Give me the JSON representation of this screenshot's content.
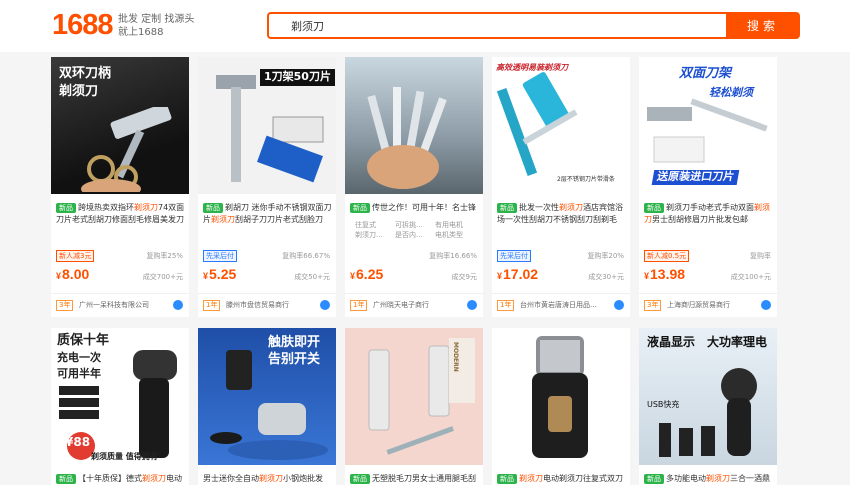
{
  "header": {
    "logo": "1688",
    "slogan_line1": "批发 定制 找源头",
    "slogan_line2": "就上1688",
    "search_value": "剃须刀",
    "search_button": "搜索"
  },
  "row1": [
    {
      "img_text1": "双环刀柄",
      "img_text2": "剃须刀",
      "badge": "新品",
      "desc_pre": "跨境热卖双指环",
      "desc_hl": "剃须刀",
      "desc_post": "74双面刀片老式刮胡刀修面刮毛修眉美发刀",
      "tag": "新人减3元",
      "repurchase": "复购率25%",
      "price": "8.00",
      "sold": "成交700+元",
      "years": "3年",
      "shop": "广州一呆科技有限公司"
    },
    {
      "img_text1": "1刀架50刀片",
      "img_text2": "",
      "badge": "新品",
      "desc_pre": "剃胡刀 迷你手动不锈钢双面刀片",
      "desc_hl": "剃须刀",
      "desc_post": "刮胡子刀刀片老式刮脸刀",
      "tag": "先采后付",
      "repurchase": "复购率66.67%",
      "price": "5.25",
      "sold": "成交50+元",
      "years": "1年",
      "shop": "滕州市盘信贸易商行"
    },
    {
      "img_text1": "",
      "img_text2": "",
      "badge": "新品",
      "desc_pre": "传世之作！可用十年！名士锋",
      "desc_hl": "",
      "desc_post": "",
      "sub1": "往复式",
      "sub2": "可拆挑…",
      "sub3": "有用电机",
      "sub4": "剃须刀…",
      "sub5": "是否内…",
      "sub6": "电机类型",
      "tag": "",
      "repurchase": "复购率16.66%",
      "price": "6.25",
      "sold": "成交9元",
      "years": "1年",
      "shop": "广州晓天电子商行"
    },
    {
      "img_text1": "高效透明易装剃须刀",
      "img_text2": "2层不锈钢刀片带滑条",
      "badge": "新品",
      "desc_pre": "批发一次性",
      "desc_hl": "剃须刀",
      "desc_post": "酒店宾馆浴场一次性刮胡刀不锈钢刮刀刮剃毛",
      "tag": "先采后付",
      "repurchase": "复购率20%",
      "price": "17.02",
      "sold": "成交30+元",
      "years": "1年",
      "shop": "台州市黄岩唐涛日用品…"
    },
    {
      "img_text1": "双面刀架",
      "img_text2": "轻松剃须",
      "img_text3": "送原装进口刀片",
      "badge": "新品",
      "desc_pre": "剃须刀手动老式手动双面",
      "desc_hl": "剃须刀",
      "desc_post": "男士刮胡修眉刀片批发包邮",
      "tag": "新人减0.5元",
      "repurchase": "复购率",
      "price": "13.98",
      "sold": "成交100+元",
      "years": "3年",
      "shop": "上海商归源贸易商行"
    }
  ],
  "row2": [
    {
      "img_text1": "质保十年",
      "img_text2": "充电一次",
      "img_text3": "可用半年",
      "img_text4": "¥88",
      "img_text5": "剃须质量 值得拥有",
      "badge": "新品",
      "desc_pre": "【十年质保】德式",
      "desc_hl": "剃须刀",
      "desc_post": "电动"
    },
    {
      "img_text1": "触肤即开",
      "img_text2": "告别开关",
      "badge": "",
      "desc_pre": "男士迷你全自动",
      "desc_hl": "剃须刀",
      "desc_post": "小钢炮批发"
    },
    {
      "img_text1": "MODERN",
      "badge": "新品",
      "desc_pre": "无塑脱毛刀男女士通用腿毛刮",
      "desc_hl": "",
      "desc_post": ""
    },
    {
      "img_text1": "",
      "badge": "新品",
      "desc_pre": "",
      "desc_hl": "剃须刀",
      "desc_post": "电动剃须刀往复式双刀"
    },
    {
      "img_text1": "液晶显示",
      "img_text2": "大功率理电",
      "img_text3": "USB快充",
      "badge": "新品",
      "desc_pre": "多功能电动",
      "desc_hl": "剃须刀",
      "desc_post": "三合一酒鼎"
    }
  ],
  "colors": {
    "brand": "#ff5000",
    "new_badge": "#2cb34a",
    "link_blue": "#2a7bff"
  },
  "icons": [
    "search-icon",
    "wangwang-icon",
    "shop-years-icon"
  ]
}
